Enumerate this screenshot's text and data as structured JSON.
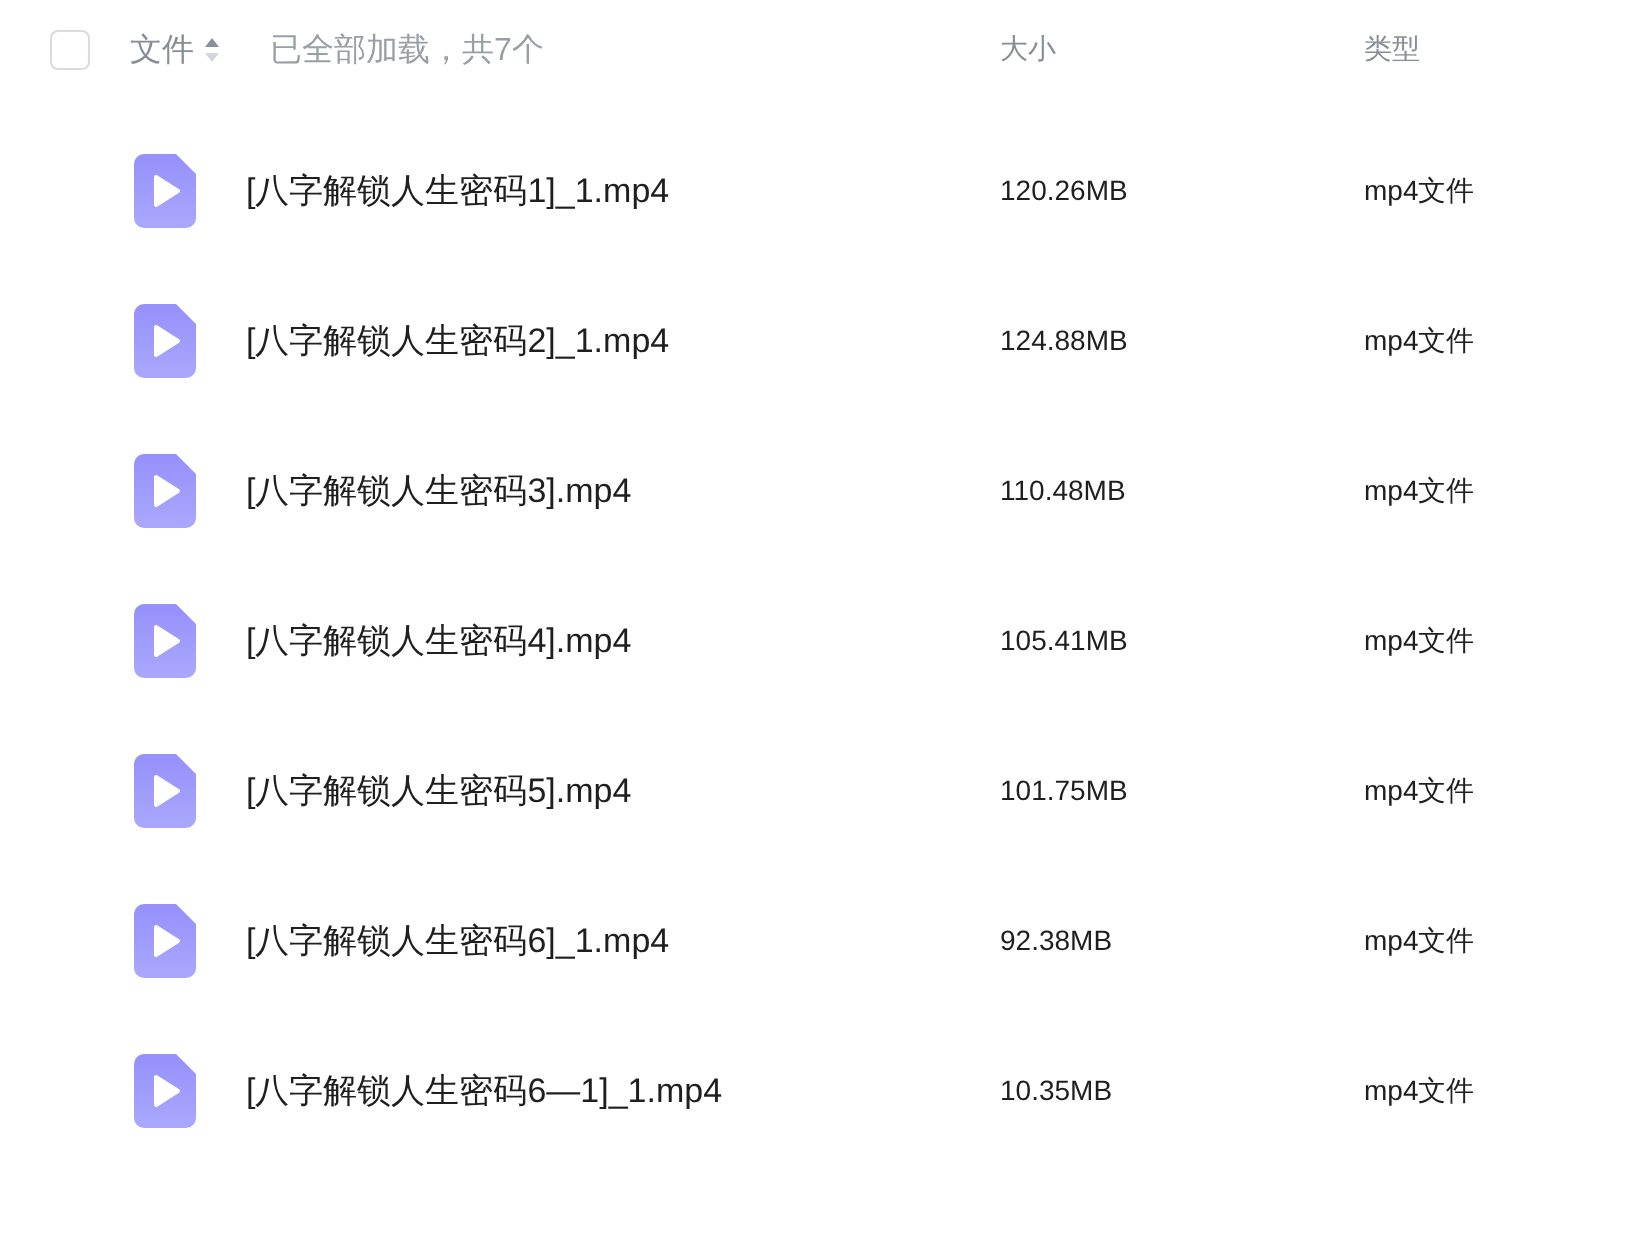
{
  "header": {
    "select_all": {
      "checked": false
    },
    "columns": [
      "文件",
      "大小",
      "类型"
    ],
    "status": "已全部加载，共7个"
  },
  "files": [
    {
      "name": "[八字解锁人生密码1]_1.mp4",
      "size": "120.26MB",
      "type": "mp4文件"
    },
    {
      "name": "[八字解锁人生密码2]_1.mp4",
      "size": "124.88MB",
      "type": "mp4文件"
    },
    {
      "name": "[八字解锁人生密码3].mp4",
      "size": "110.48MB",
      "type": "mp4文件"
    },
    {
      "name": "[八字解锁人生密码4].mp4",
      "size": "105.41MB",
      "type": "mp4文件"
    },
    {
      "name": "[八字解锁人生密码5].mp4",
      "size": "101.75MB",
      "type": "mp4文件"
    },
    {
      "name": "[八字解锁人生密码6]_1.mp4",
      "size": "92.38MB",
      "type": "mp4文件"
    },
    {
      "name": "[八字解锁人生密码6—1]_1.mp4",
      "size": "10.35MB",
      "type": "mp4文件"
    }
  ]
}
